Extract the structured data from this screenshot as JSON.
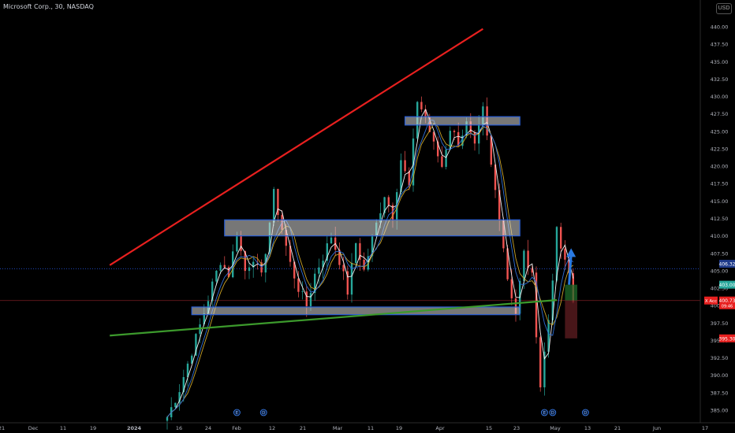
{
  "header": {
    "symbol_title": "Microsoft Corp., 30, NASDAQ",
    "currency_label": "USD"
  },
  "colors": {
    "background": "#000000",
    "up_candle": "#26a69a",
    "down_candle": "#ef5350",
    "resistance_trendline": "#e8201f",
    "support_trendline": "#3c9a2c",
    "zone_fill": "#d8d8d8",
    "zone_border": "#2a5fd8",
    "arrow": "#2a7ae2",
    "ma_white": "#f0f0f0",
    "ma_yellow": "#c9a227",
    "ma_blue": "#2f6fd6",
    "target_box": "#1d6b2a",
    "stop_box": "#5a1c1f"
  },
  "chart_data": {
    "type": "candlestick",
    "title": "Microsoft Corp., 30, NASDAQ",
    "ylim": [
      384,
      441.5
    ],
    "y_ticks": [
      "440.00",
      "437.50",
      "435.00",
      "432.50",
      "430.00",
      "427.50",
      "425.00",
      "422.50",
      "420.00",
      "417.50",
      "415.00",
      "412.50",
      "410.00",
      "407.50",
      "405.00",
      "402.50",
      "400.00",
      "397.50",
      "395.00",
      "392.50",
      "390.00",
      "387.50",
      "385.00"
    ],
    "x_tick_labels": [
      "21",
      "Dec",
      "11",
      "19",
      "2024",
      "16",
      "24",
      "Feb",
      "12",
      "21",
      "Mar",
      "11",
      "19",
      "Apr",
      "15",
      "23",
      "May",
      "13",
      "21",
      "Jun",
      "17"
    ],
    "price_path": [
      {
        "i": 0,
        "p": 384.0
      },
      {
        "i": 3,
        "p": 388.0
      },
      {
        "i": 6,
        "p": 393.5
      },
      {
        "i": 9,
        "p": 399.0
      },
      {
        "i": 11,
        "p": 403.0
      },
      {
        "i": 13,
        "p": 406.5
      },
      {
        "i": 15,
        "p": 404.5
      },
      {
        "i": 17,
        "p": 410.5
      },
      {
        "i": 19,
        "p": 405.0
      },
      {
        "i": 21,
        "p": 407.0
      },
      {
        "i": 23,
        "p": 404.0
      },
      {
        "i": 26,
        "p": 416.0
      },
      {
        "i": 28,
        "p": 411.0
      },
      {
        "i": 30,
        "p": 406.0
      },
      {
        "i": 32,
        "p": 402.5
      },
      {
        "i": 34,
        "p": 400.0
      },
      {
        "i": 36,
        "p": 404.5
      },
      {
        "i": 38,
        "p": 407.0
      },
      {
        "i": 40,
        "p": 410.0
      },
      {
        "i": 42,
        "p": 406.5
      },
      {
        "i": 44,
        "p": 402.0
      },
      {
        "i": 46,
        "p": 409.0
      },
      {
        "i": 48,
        "p": 405.0
      },
      {
        "i": 50,
        "p": 409.5
      },
      {
        "i": 53,
        "p": 416.0
      },
      {
        "i": 55,
        "p": 413.0
      },
      {
        "i": 57,
        "p": 421.0
      },
      {
        "i": 59,
        "p": 417.0
      },
      {
        "i": 61,
        "p": 429.5
      },
      {
        "i": 63,
        "p": 427.0
      },
      {
        "i": 65,
        "p": 423.0
      },
      {
        "i": 67,
        "p": 420.0
      },
      {
        "i": 69,
        "p": 425.5
      },
      {
        "i": 71,
        "p": 423.5
      },
      {
        "i": 73,
        "p": 426.0
      },
      {
        "i": 75,
        "p": 422.5
      },
      {
        "i": 77,
        "p": 428.0
      },
      {
        "i": 79,
        "p": 420.0
      },
      {
        "i": 81,
        "p": 413.0
      },
      {
        "i": 83,
        "p": 404.0
      },
      {
        "i": 85,
        "p": 399.0
      },
      {
        "i": 87,
        "p": 407.5
      },
      {
        "i": 89,
        "p": 404.0
      },
      {
        "i": 91,
        "p": 388.5
      },
      {
        "i": 93,
        "p": 398.0
      },
      {
        "i": 95,
        "p": 410.5
      },
      {
        "i": 97,
        "p": 406.0
      },
      {
        "i": 98,
        "p": 404.5
      },
      {
        "i": 99,
        "p": 400.5
      }
    ],
    "moving_averages": [
      {
        "name": "MA white",
        "color": "#f0f0f0",
        "lag": 2
      },
      {
        "name": "MA yellow",
        "color": "#c9a227",
        "lag": 5
      },
      {
        "name": "MA blue",
        "color": "#2f6fd6",
        "lag": 4
      }
    ],
    "zones": [
      {
        "name": "resistance-zone-upper",
        "x0": 58,
        "x1": 86,
        "y_low": 425.9,
        "y_high": 427.1
      },
      {
        "name": "middle-zone",
        "x0": 14,
        "x1": 86,
        "y_low": 410.0,
        "y_high": 412.3
      },
      {
        "name": "support-zone-lower",
        "x0": 6,
        "x1": 86,
        "y_low": 398.7,
        "y_high": 399.8
      }
    ],
    "trendlines": [
      {
        "name": "resistance-trendline",
        "color": "#e8201f",
        "from": {
          "i": -14,
          "p": 405.8
        },
        "to": {
          "i": 77,
          "p": 439.7
        }
      },
      {
        "name": "support-trendline",
        "color": "#3c9a2c",
        "from": {
          "i": -14,
          "p": 395.7
        },
        "to": {
          "i": 95,
          "p": 400.8
        }
      }
    ],
    "position_tool": {
      "entry": 400.73,
      "target": 403.0,
      "stop": 395.3,
      "from_i": 97,
      "to_i": 100
    },
    "arrow": {
      "from": {
        "i": 98,
        "p": 403.0
      },
      "to": {
        "i": 98.5,
        "p": 408.0
      }
    },
    "reference_lines": [
      {
        "name": "last-price-line",
        "price": 405.3,
        "color": "#2962ff",
        "style": "dotted"
      },
      {
        "name": "alert-line",
        "price": 400.73,
        "color": "#7b1f25",
        "style": "solid"
      }
    ],
    "price_labels": [
      {
        "name": "last-price-label",
        "price": 406.0,
        "text": "406.32",
        "bg": "#1e3a8a",
        "fg": "#ffffff"
      },
      {
        "name": "target-price-label",
        "price": 403.0,
        "text": "403.00",
        "bg": "#26a69a",
        "fg": "#ffffff"
      },
      {
        "name": "entry-price-label",
        "price": 400.73,
        "text": "400.73",
        "bg": "#e8201f",
        "fg": "#ffffff",
        "sub": "09:46"
      },
      {
        "name": "stop-price-label",
        "price": 395.3,
        "text": "395.30",
        "bg": "#e8201f",
        "fg": "#ffffff"
      }
    ],
    "axis_tag": {
      "name": "axis-tag",
      "text": "X Acc",
      "bg": "#e8201f"
    },
    "event_markers": [
      {
        "name": "earnings-marker-1",
        "i": 17,
        "letter": "E"
      },
      {
        "name": "dividend-marker-1",
        "i": 23.5,
        "letter": "D"
      },
      {
        "name": "earnings-marker-2",
        "i": 92,
        "letter": "E"
      },
      {
        "name": "dividend-marker-2",
        "i": 94,
        "letter": "D"
      },
      {
        "name": "dividend-marker-3",
        "i": 102,
        "letter": "D"
      }
    ]
  }
}
